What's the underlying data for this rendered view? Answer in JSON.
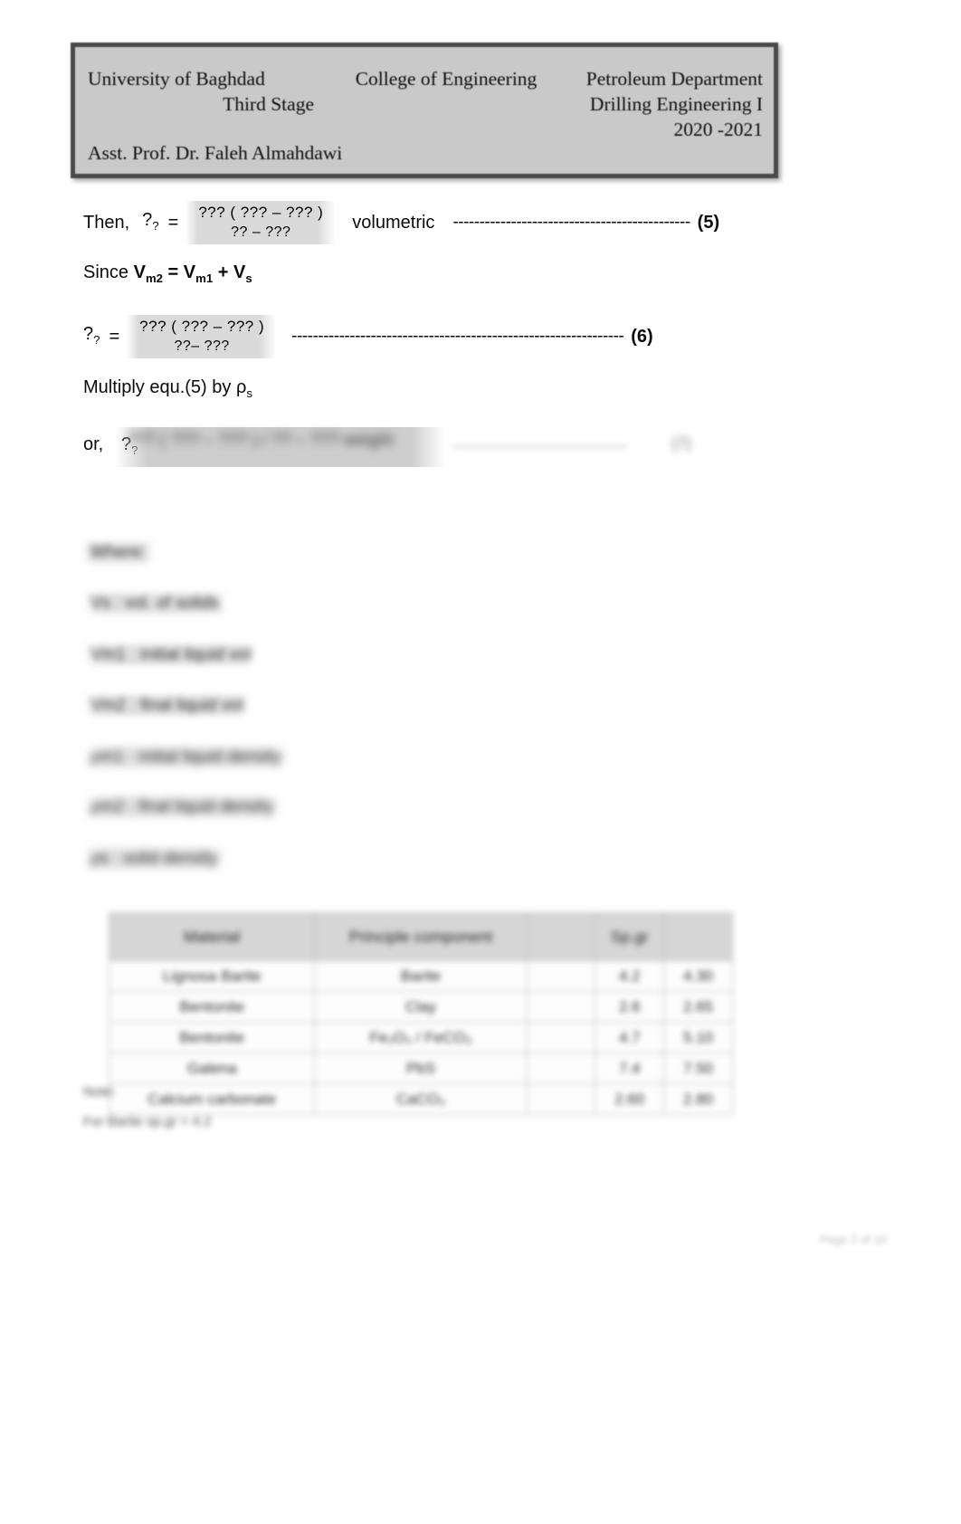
{
  "header": {
    "university": "University of Baghdad",
    "stage": "Third Stage",
    "college": "College of Engineering",
    "department": "Petroleum Department",
    "course": "Drilling Engineering I",
    "year": "2020 -2021",
    "instructor": "Asst. Prof. Dr. Faleh Almahdawi"
  },
  "body": {
    "then_label": "Then,",
    "eq5": {
      "lhs": "?",
      "lhs_sub": "?",
      "equals": "=",
      "numerator": "???   ( ???   –  ???   )",
      "denominator": "?? – ???",
      "trailing_word": "volumetric",
      "dashes": "---------------------------------------------",
      "number": "(5)"
    },
    "since_line": {
      "prefix": "Since ",
      "v_m2": "V",
      "v_m2_sub": "m2",
      "eq": " = ",
      "v_m1": "V",
      "v_m1_sub": "m1",
      "plus": " + ",
      "v_s": "V",
      "v_s_sub": "s"
    },
    "eq6": {
      "lhs": "?",
      "lhs_sub": "?",
      "equals": "=",
      "numerator": "???   ( ???   –  ???   )",
      "denominator": "??–  ???",
      "dashes": "---------------------------------------------------------------",
      "number": "(6)"
    },
    "multiply_line": {
      "text": "Multiply equ.(5) by ρ",
      "sub": "s"
    },
    "or_line": {
      "prefix": "or,",
      "lhs": "?",
      "lhs_sub": "?",
      "equation": "??? ( ??? – ??? ) / ?? – ???    weight",
      "dashes": "-----------------------------------",
      "number": "(7)"
    },
    "where_label": "Where:",
    "definitions": [
      "Vs : vol. of solids",
      "Vm1 : initial liquid vol",
      "Vm2 : final liquid vol",
      "ρm1 : initial liquid density",
      "ρm2 : final liquid density",
      "ρs : solid density"
    ]
  },
  "table": {
    "headers": [
      "Material",
      "Principle component",
      "",
      "Sp.gr",
      ""
    ],
    "rows": [
      [
        "Lignosa Barite",
        "Barite",
        "",
        "4.2",
        "4.30"
      ],
      [
        "Bentonite",
        "Clay",
        "",
        "2.6",
        "2.65"
      ],
      [
        "Bentonite",
        "Fe₂O₃ / FeCO₃",
        "",
        "4.7",
        "5.10"
      ],
      [
        "Galena",
        "PbS",
        "",
        "7.4",
        "7.50"
      ],
      [
        "Calcium carbonate",
        "CaCO₃",
        "",
        "2.60",
        "2.80"
      ]
    ]
  },
  "notes": {
    "note_label": "Note:",
    "note_text": "For Barite sp.gr = 4.2"
  },
  "footer": {
    "page_number": "Page 2 of 10"
  },
  "colors": {
    "header_fill": "#c9c9c9",
    "header_border": "#4a4a4a",
    "table_header_fill": "#d6d6d6",
    "text": "#000000"
  }
}
